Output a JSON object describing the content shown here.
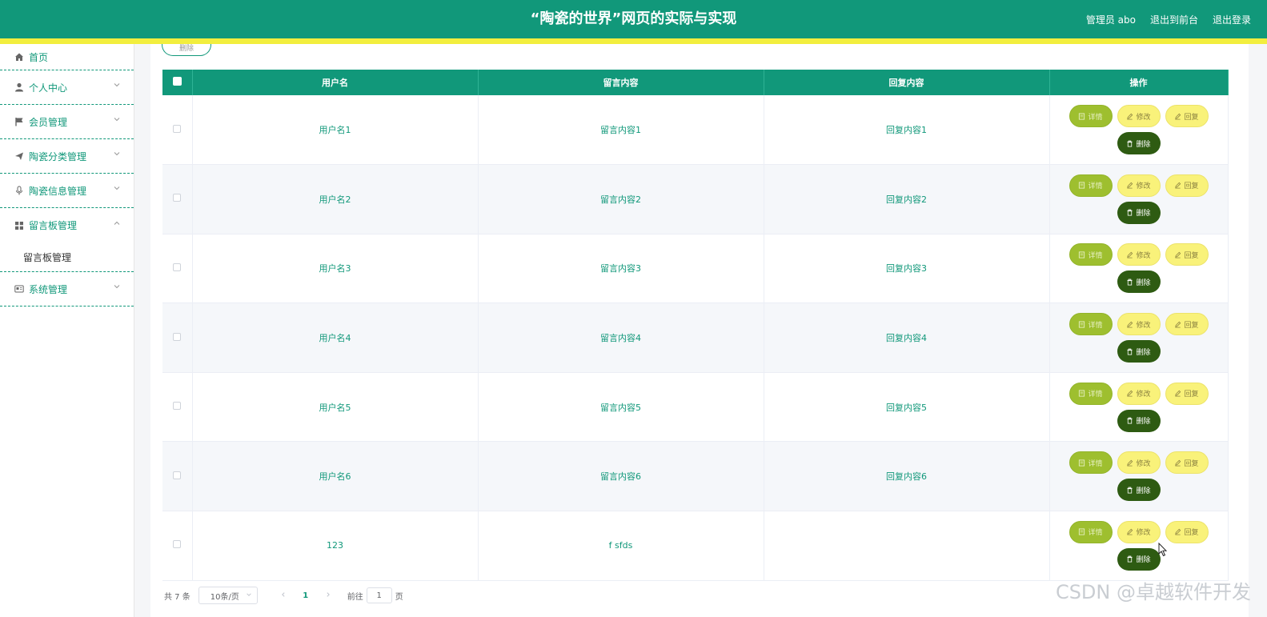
{
  "header": {
    "title": "“陶瓷的世界”网页的实际与实现",
    "admin_label": "管理员 abo",
    "back_front": "退出到前台",
    "logout": "退出登录"
  },
  "sidebar": {
    "items": [
      {
        "label": "首页",
        "icon": "home-icon"
      },
      {
        "label": "个人中心",
        "icon": "user-icon"
      },
      {
        "label": "会员管理",
        "icon": "flag-icon"
      },
      {
        "label": "陶瓷分类管理",
        "icon": "send-icon"
      },
      {
        "label": "陶瓷信息管理",
        "icon": "microphone-icon"
      },
      {
        "label": "留言板管理",
        "icon": "grid-icon"
      },
      {
        "label": "系统管理",
        "icon": "card-icon"
      }
    ],
    "sub_item": "留言板管理"
  },
  "toolbar": {
    "delete_label": "删除"
  },
  "table": {
    "headers": [
      "用户名",
      "留言内容",
      "回复内容",
      "操作"
    ],
    "rows": [
      {
        "username": "用户名1",
        "message": "留言内容1",
        "reply": "回复内容1"
      },
      {
        "username": "用户名2",
        "message": "留言内容2",
        "reply": "回复内容2"
      },
      {
        "username": "用户名3",
        "message": "留言内容3",
        "reply": "回复内容3"
      },
      {
        "username": "用户名4",
        "message": "留言内容4",
        "reply": "回复内容4"
      },
      {
        "username": "用户名5",
        "message": "留言内容5",
        "reply": "回复内容5"
      },
      {
        "username": "用户名6",
        "message": "留言内容6",
        "reply": "回复内容6"
      },
      {
        "username": "123",
        "message": "f sfds",
        "reply": ""
      }
    ],
    "actions": {
      "detail": "详情",
      "edit": "修改",
      "reply": "回复",
      "delete": "删除"
    }
  },
  "pager": {
    "total": "共 7 条",
    "page_size": "10条/页",
    "current_page": "1",
    "goto_prefix": "前往",
    "goto_value": "1",
    "goto_suffix": "页"
  },
  "watermark": "CSDN @卓越软件开发",
  "colors": {
    "primary": "#11987a",
    "stripe": "#f2ee3e",
    "detail": "#9ebf2f",
    "edit": "#f9f27a",
    "delete": "#2e5b12"
  }
}
